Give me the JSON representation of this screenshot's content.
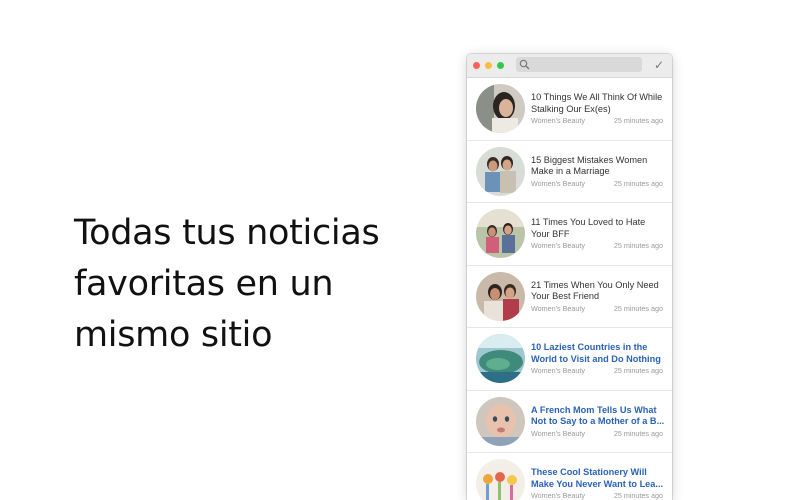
{
  "tagline": {
    "line1": "Todas tus noticias",
    "line2": "favoritas en un",
    "line3": "mismo sitio"
  },
  "window": {
    "search_icon": "search-icon",
    "done_glyph": "✓"
  },
  "articles": [
    {
      "title_line1": "10 Things We All Think Of While",
      "title_line2": "Stalking Our Ex(es)",
      "source": "Women's Beauty",
      "time": "25 minutes ago",
      "unread": false
    },
    {
      "title_line1": "15 Biggest Mistakes Women",
      "title_line2": "Make in a Marriage",
      "source": "Women's Beauty",
      "time": "25 minutes ago",
      "unread": false
    },
    {
      "title_line1": "11 Times You Loved to Hate",
      "title_line2": "Your BFF",
      "source": "Women's Beauty",
      "time": "25 minutes ago",
      "unread": false
    },
    {
      "title_line1": "21 Times When You Only Need",
      "title_line2": "Your Best Friend",
      "source": "Women's Beauty",
      "time": "25 minutes ago",
      "unread": false
    },
    {
      "title_line1": "10 Laziest Countries in the",
      "title_line2": "World to Visit and Do Nothing",
      "source": "Women's Beauty",
      "time": "25 minutes ago",
      "unread": true
    },
    {
      "title_line1": "A French Mom Tells Us What",
      "title_line2": "Not to Say to a Mother of a B...",
      "source": "Women's Beauty",
      "time": "25 minutes ago",
      "unread": true
    },
    {
      "title_line1": "These Cool Stationery Will",
      "title_line2": "Make You Never Want to Lea...",
      "source": "Women's Beauty",
      "time": "25 minutes ago",
      "unread": true
    }
  ],
  "colors": {
    "unread_title": "#2a62b5",
    "close": "#fc605b",
    "minimize": "#fdbc40",
    "zoom": "#34c84a"
  }
}
